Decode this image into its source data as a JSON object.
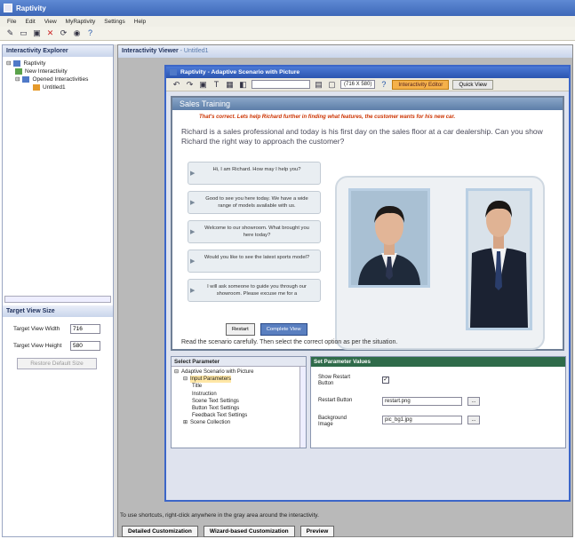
{
  "app": {
    "title": "Raptivity"
  },
  "menu": [
    "File",
    "Edit",
    "View",
    "MyRaptivity",
    "Settings",
    "Help"
  ],
  "explorer": {
    "title": "Interactivity Explorer",
    "tree": [
      "Raptivity",
      "New Interactivity",
      "Opened Interactivities",
      "Untitled1"
    ]
  },
  "target": {
    "title": "Target View Size",
    "width_label": "Target View Width",
    "width_value": "716",
    "height_label": "Target View Height",
    "height_value": "580",
    "restore_label": "Restore Default Size"
  },
  "viewer": {
    "title": "Interactivity Viewer",
    "subtitle": " - Untitled1",
    "hint": "To use shortcuts, right-click anywhere in the gray area around the interactivity.",
    "buttons": [
      "Detailed Customization",
      "Wizard-based Customization",
      "Preview"
    ]
  },
  "inner": {
    "title": "Raptivity - Adaptive Scenario with Picture",
    "zoom": "(716 X 580)",
    "tab_active": "Interactivity Editor",
    "tab_other": "Quick View"
  },
  "sim": {
    "header": "Sales Training",
    "feedback": "That's correct. Lets help Richard further in finding what features, the customer wants for his new car.",
    "question": "Richard is a sales professional and today is his first day on the sales floor at a car dealership. Can you show Richard the right way to approach the customer?",
    "options": [
      "Hi, I am Richard. How may I help you?",
      "Good to see you here today. We have a wide range of models available with us.",
      "Welcome to our showroom. What brought you here today?",
      "Would you like to see the latest sports model?",
      "I will ask someone to guide you through our showroom. Please excuse me for a"
    ],
    "restart_label": "Restart",
    "complete_label": "Complete View",
    "instruction": "Read the scenario carefully. Then select the correct option as per the situation."
  },
  "select_params": {
    "title": "Select Parameter",
    "tree": [
      "Adaptive Scenario with Picture",
      "Input Parameters",
      "Title",
      "Instruction",
      "Scene Text Settings",
      "Button Text Settings",
      "Feedback Text Settings",
      "Scene Collection"
    ]
  },
  "set_values": {
    "title": "Set Parameter Values",
    "show_restart_label": "Show Restart Button",
    "restart_button_label": "Restart Button",
    "restart_button_value": "restart.png",
    "background_label": "Background Image",
    "background_value": "pic_bg1.jpg",
    "browse": "..."
  },
  "colors": {
    "accent": "#3c66c8",
    "tab_active": "#f5b14a",
    "feedback": "#cc3300"
  }
}
